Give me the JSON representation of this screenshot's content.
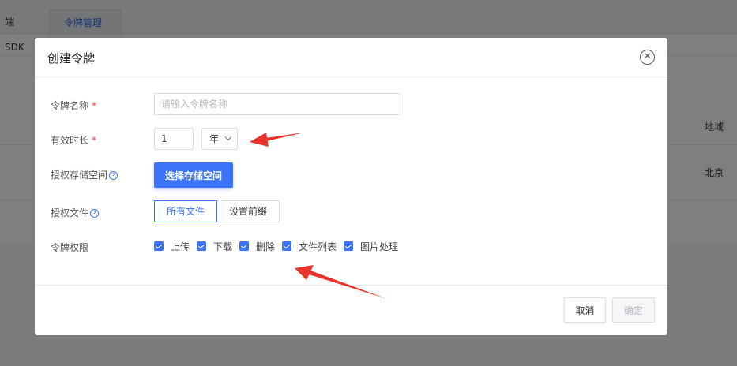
{
  "background": {
    "tabs": [
      "端SDK",
      "令牌管理"
    ],
    "table_cells": [
      "地域",
      "北京"
    ]
  },
  "dialog": {
    "title": "创建令牌",
    "close_icon": "close-circle-icon",
    "fields": {
      "name": {
        "label": "令牌名称",
        "required_mark": "*",
        "placeholder": "请输入令牌名称",
        "value": ""
      },
      "duration": {
        "label": "有效时长",
        "required_mark": "*",
        "value": "1",
        "unit": "年"
      },
      "storage": {
        "label": "授权存储空间",
        "help": "?",
        "button": "选择存储空间"
      },
      "files": {
        "label": "授权文件",
        "help": "?",
        "options": [
          "所有文件",
          "设置前缀"
        ],
        "selected": "所有文件"
      },
      "permissions": {
        "label": "令牌权限",
        "items": [
          {
            "label": "上传",
            "checked": true
          },
          {
            "label": "下载",
            "checked": true
          },
          {
            "label": "删除",
            "checked": true
          },
          {
            "label": "文件列表",
            "checked": true
          },
          {
            "label": "图片处理",
            "checked": true
          }
        ]
      }
    },
    "footer": {
      "cancel": "取消",
      "confirm": "确定"
    }
  },
  "colors": {
    "primary": "#3b74f6",
    "required": "#e4393c",
    "annotation_arrow": "#e8322c"
  }
}
